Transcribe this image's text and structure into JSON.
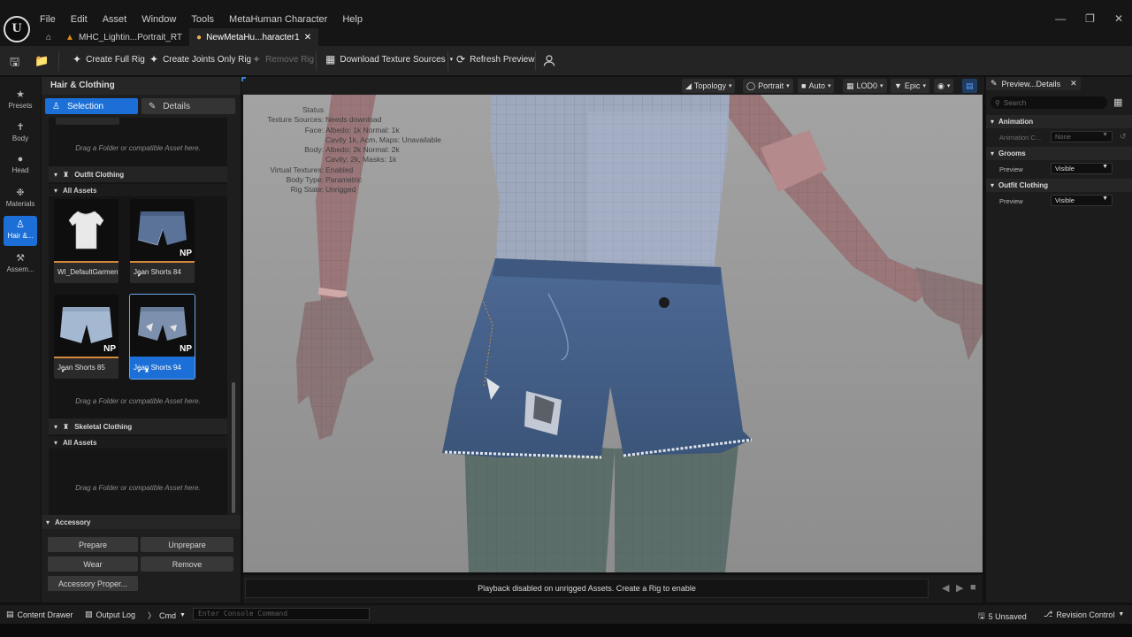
{
  "app": {
    "logo": "U",
    "menu": [
      "File",
      "Edit",
      "Asset",
      "Window",
      "Tools",
      "MetaHuman Character",
      "Help"
    ],
    "tabs": [
      {
        "label": "MHC_Lightin...Portrait_RT",
        "active": false
      },
      {
        "label": "NewMetaHu...haracter1",
        "active": true
      }
    ]
  },
  "toolbar": {
    "create_full_rig": "Create Full Rig",
    "create_joints_only_rig": "Create Joints Only Rig",
    "remove_rig": "Remove Rig",
    "download_texture_sources": "Download Texture Sources",
    "refresh_preview": "Refresh Preview"
  },
  "rail": {
    "items": [
      "Presets",
      "Body",
      "Head",
      "Materials",
      "Hair &...",
      "Assem..."
    ],
    "active": "Hair &..."
  },
  "left_panel": {
    "title": "Hair & Clothing",
    "selection_label": "Selection",
    "details_label": "Details",
    "drop_hint": "Drag a Folder or compatible Asset here.",
    "outfit_clothing": "Outfit Clothing",
    "all_assets": "All Assets",
    "skeletal_clothing": "Skeletal Clothing",
    "assets": [
      {
        "label": "WI_DefaultGarment"
      },
      {
        "label": "Jean Shorts 84",
        "badge": "NP"
      },
      {
        "label": "Jean Shorts 85",
        "badge": "NP"
      },
      {
        "label": "Jean Shorts 94",
        "badge": "NP"
      }
    ],
    "selected_asset": "Jean Shorts 94"
  },
  "accessory": {
    "title": "Accessory",
    "prepare": "Prepare",
    "unprepare": "Unprepare",
    "wear": "Wear",
    "remove": "Remove",
    "properties": "Accessory Proper..."
  },
  "viewport": {
    "chips": [
      "Topology",
      "Portrait",
      "Auto",
      "LOD0",
      "Epic"
    ],
    "status_title": "Status",
    "status": [
      {
        "k": "Texture Sources:",
        "v": "Needs download"
      },
      {
        "k": "Face:",
        "v": "Albedo: 1k Normal: 1k"
      },
      {
        "k": "",
        "v": "Cavity 1k, Acm, Maps: Unavailable"
      },
      {
        "k": "Body:",
        "v": "Albedo: 2k Normal: 2k"
      },
      {
        "k": "",
        "v": "Cavity: 2k, Masks: 1k"
      },
      {
        "k": "Virtual Textures:",
        "v": "Enabled"
      },
      {
        "k": "Body Type:",
        "v": "Parametric"
      },
      {
        "k": "Rig State:",
        "v": "Unrigged"
      }
    ],
    "playback_message": "Playback disabled on unrigged Assets. Create a Rig to enable"
  },
  "right_panel": {
    "tab_label": "Preview...Details",
    "search_placeholder": "Search",
    "animation": "Animation",
    "animation_label": "Animation C...",
    "animation_value": "None",
    "grooms": "Grooms",
    "outfit_clothing": "Outfit Clothing",
    "preview_label": "Preview",
    "visible_value": "Visible"
  },
  "statusbar": {
    "content_drawer": "Content Drawer",
    "output_log": "Output Log",
    "cmd": "Cmd",
    "console_placeholder": "Enter Console Command",
    "unsaved": "5 Unsaved",
    "revision_control": "Revision Control"
  }
}
